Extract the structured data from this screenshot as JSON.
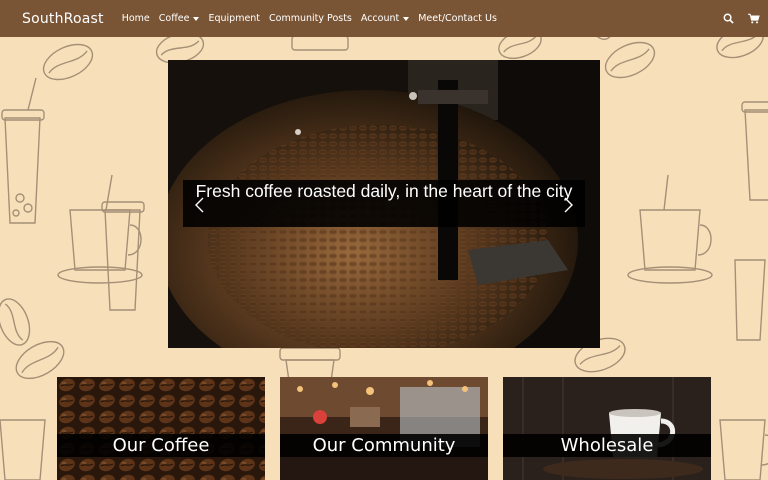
{
  "navbar": {
    "brand": "SouthRoast",
    "items": [
      {
        "label": "Home",
        "dropdown": false
      },
      {
        "label": "Coffee",
        "dropdown": true
      },
      {
        "label": "Equipment",
        "dropdown": false
      },
      {
        "label": "Community Posts",
        "dropdown": false
      },
      {
        "label": "Account",
        "dropdown": true
      },
      {
        "label": "Meet/Contact Us",
        "dropdown": false
      }
    ],
    "icons": [
      "search-icon",
      "cart-icon"
    ]
  },
  "hero": {
    "caption": "Fresh coffee roasted daily, in the heart of the city"
  },
  "cards": [
    {
      "label": "Our Coffee"
    },
    {
      "label": "Our Community"
    },
    {
      "label": "Wholesale"
    }
  ],
  "colors": {
    "navbar": "#7a5535",
    "background": "#f7e0b9",
    "doodle": "#8a7560"
  }
}
